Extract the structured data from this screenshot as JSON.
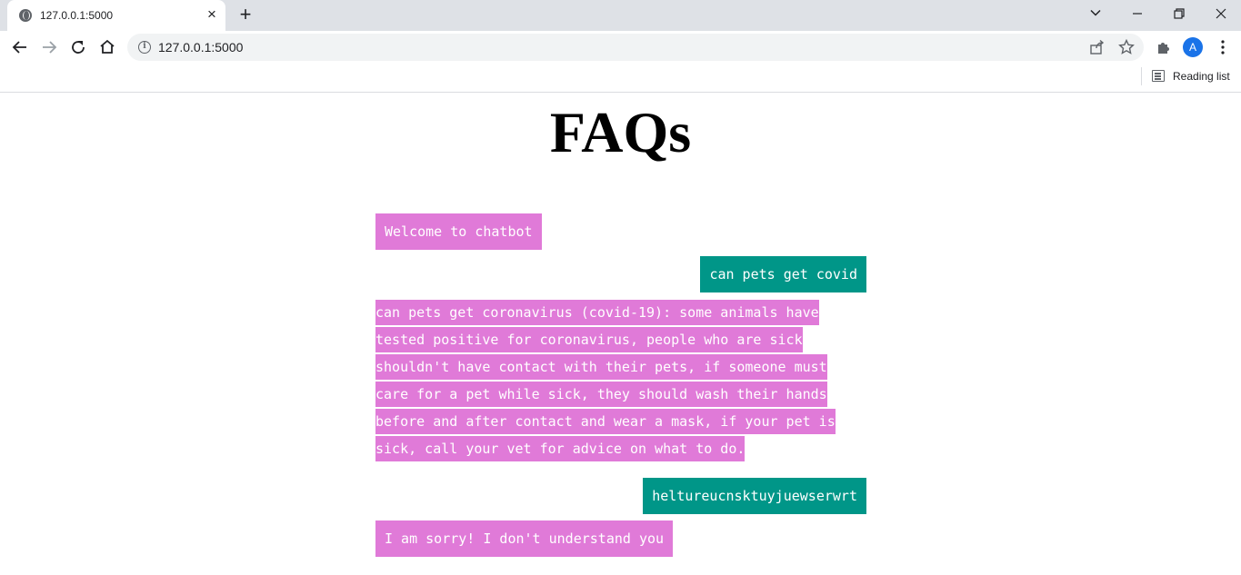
{
  "browser": {
    "tab_title": "127.0.0.1:5000",
    "url": "127.0.0.1:5000",
    "avatar_letter": "A",
    "reading_list_label": "Reading list"
  },
  "page": {
    "title": "FAQs"
  },
  "chat": {
    "messages": [
      {
        "sender": "bot",
        "text": "Welcome to chatbot"
      },
      {
        "sender": "user",
        "text": "can pets get covid"
      },
      {
        "sender": "bot",
        "text": " can pets get coronavirus (covid-19): some animals have tested positive for coronavirus, people who are sick shouldn't have contact with their pets, if someone must care for a pet while sick, they should wash their hands before and after contact and wear a mask, if your pet is sick, call your vet for advice on what to do. "
      },
      {
        "sender": "user",
        "text": "heltureucnsktuyjuewserwrt"
      },
      {
        "sender": "bot",
        "text": "I am sorry! I don't understand you"
      }
    ]
  },
  "colors": {
    "bot_bubble": "#e07ad8",
    "user_bubble": "#009688",
    "accent": "#1a73e8"
  }
}
